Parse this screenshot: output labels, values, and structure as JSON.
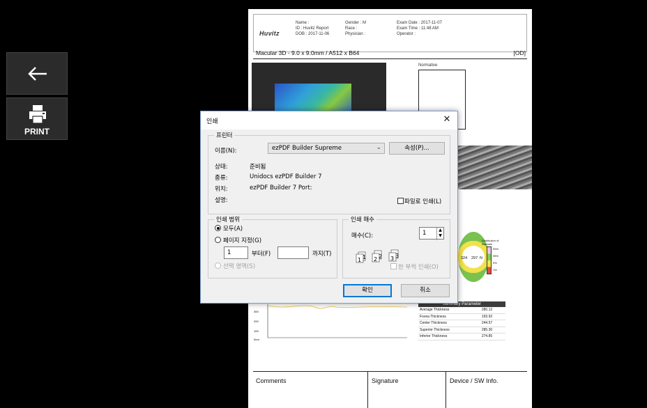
{
  "sidebar": {
    "back_icon": "left-arrow-icon",
    "print_icon": "printer-icon",
    "print_label": "PRINT"
  },
  "report": {
    "logo": "Huvitz",
    "header": {
      "name": "Name :",
      "id": "ID : Huvitz Report",
      "dob": "DOB : 2017-11-06",
      "gender": "Gender : M",
      "race": "Race :",
      "physician": "Physician :",
      "exam_date": "Exam Date : 2017-11-07",
      "exam_time": "Exam Time : 11:48 AM",
      "operator": "Operator :"
    },
    "title": "Macular 3D - 9.0 x 9.0mm / A512 x B64",
    "eye": "[OD]",
    "normative_label": "Normative",
    "ring_values": {
      "a": "324",
      "b": "297",
      "c": "N"
    },
    "colorbar_title": "Distribution of Normals",
    "colorbar_labels": [
      "99%",
      "95%",
      "5%",
      "1%"
    ],
    "graph_labels": [
      "300",
      "200",
      "100",
      "0um"
    ],
    "summary": {
      "header": "Summary Parameter",
      "rows": [
        {
          "label": "Average Thickness",
          "value": "280.12"
        },
        {
          "label": "Fovea Thickness",
          "value": "193.92"
        },
        {
          "label": "Center Thickness",
          "value": "244.57"
        },
        {
          "label": "Superior Thickness",
          "value": "285.30"
        },
        {
          "label": "Inferior Thickness",
          "value": "274.85"
        }
      ]
    },
    "footer": {
      "comments": "Comments",
      "signature": "Signature",
      "device": "Device / SW Info."
    }
  },
  "dialog": {
    "title": "인쇄",
    "close_icon": "close-icon",
    "printer_group": "프린터",
    "name_label": "이름(N):",
    "printer_name": "ezPDF Builder Supreme",
    "properties_button": "속성(P)...",
    "status_label": "상태:",
    "status_value": "준비됨",
    "type_label": "종류:",
    "type_value": "Unidocs ezPDF Builder 7",
    "where_label": "위치:",
    "where_value": "ezPDF Builder 7 Port:",
    "comment_label": "설명:",
    "print_to_file": "파일로 인쇄(L)",
    "range_group": "인쇄 범위",
    "range_all": "모두(A)",
    "range_pages": "페이지 지정(G)",
    "from_value": "1",
    "from_label": "부터(F)",
    "to_value": "",
    "to_label": "까지(T)",
    "range_selection": "선택 영역(S)",
    "copies_group": "인쇄 매수",
    "copies_label": "매수(C):",
    "copies_value": "1",
    "collate_label": "한 부씩 인쇄(O)",
    "ok_button": "확인",
    "cancel_button": "취소"
  }
}
